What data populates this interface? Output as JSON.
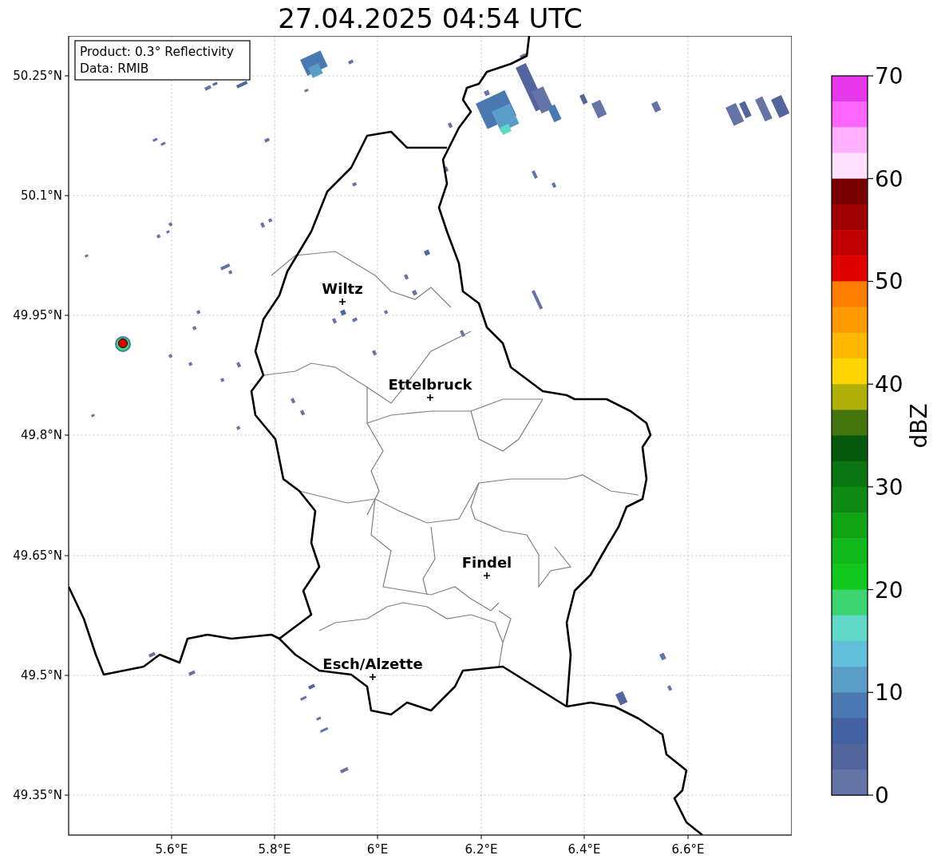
{
  "title": "27.04.2025 04:54 UTC",
  "info_box": [
    "Product: 0.3° Reflectivity",
    "Data: RMIB"
  ],
  "map": {
    "x_ticks": [
      "5.6°E",
      "5.8°E",
      "6°E",
      "6.2°E",
      "6.4°E",
      "6.6°E"
    ],
    "y_ticks": [
      "50.25°N",
      "50.1°N",
      "49.95°N",
      "49.8°N",
      "49.65°N",
      "49.5°N",
      "49.35°N"
    ],
    "places": [
      {
        "name": "Wiltz"
      },
      {
        "name": "Ettelbruck"
      },
      {
        "name": "Findel"
      },
      {
        "name": "Esch/Alzette"
      }
    ]
  },
  "colorbar": {
    "label": "dBZ",
    "ticks": [
      "70",
      "60",
      "50",
      "40",
      "30",
      "20",
      "10",
      "0"
    ],
    "bins": [
      {
        "color": "#e637ec"
      },
      {
        "color": "#ff66ff"
      },
      {
        "color": "#ffb0ff"
      },
      {
        "color": "#ffe0ff"
      },
      {
        "color": "#780000"
      },
      {
        "color": "#a00000"
      },
      {
        "color": "#c00000"
      },
      {
        "color": "#e00000"
      },
      {
        "color": "#ff7e00"
      },
      {
        "color": "#ff9a00"
      },
      {
        "color": "#ffb800"
      },
      {
        "color": "#ffd500"
      },
      {
        "color": "#b0b008"
      },
      {
        "color": "#44740c"
      },
      {
        "color": "#06580c"
      },
      {
        "color": "#0a7410"
      },
      {
        "color": "#0c8a14"
      },
      {
        "color": "#10a414"
      },
      {
        "color": "#10b81a"
      },
      {
        "color": "#12c81d"
      },
      {
        "color": "#3dd56f"
      },
      {
        "color": "#60d8c8"
      },
      {
        "color": "#62c0dc"
      },
      {
        "color": "#5a9ec8"
      },
      {
        "color": "#4a78b0"
      },
      {
        "color": "#4360a0"
      },
      {
        "color": "#53659d"
      },
      {
        "color": "#6474a6"
      }
    ]
  }
}
